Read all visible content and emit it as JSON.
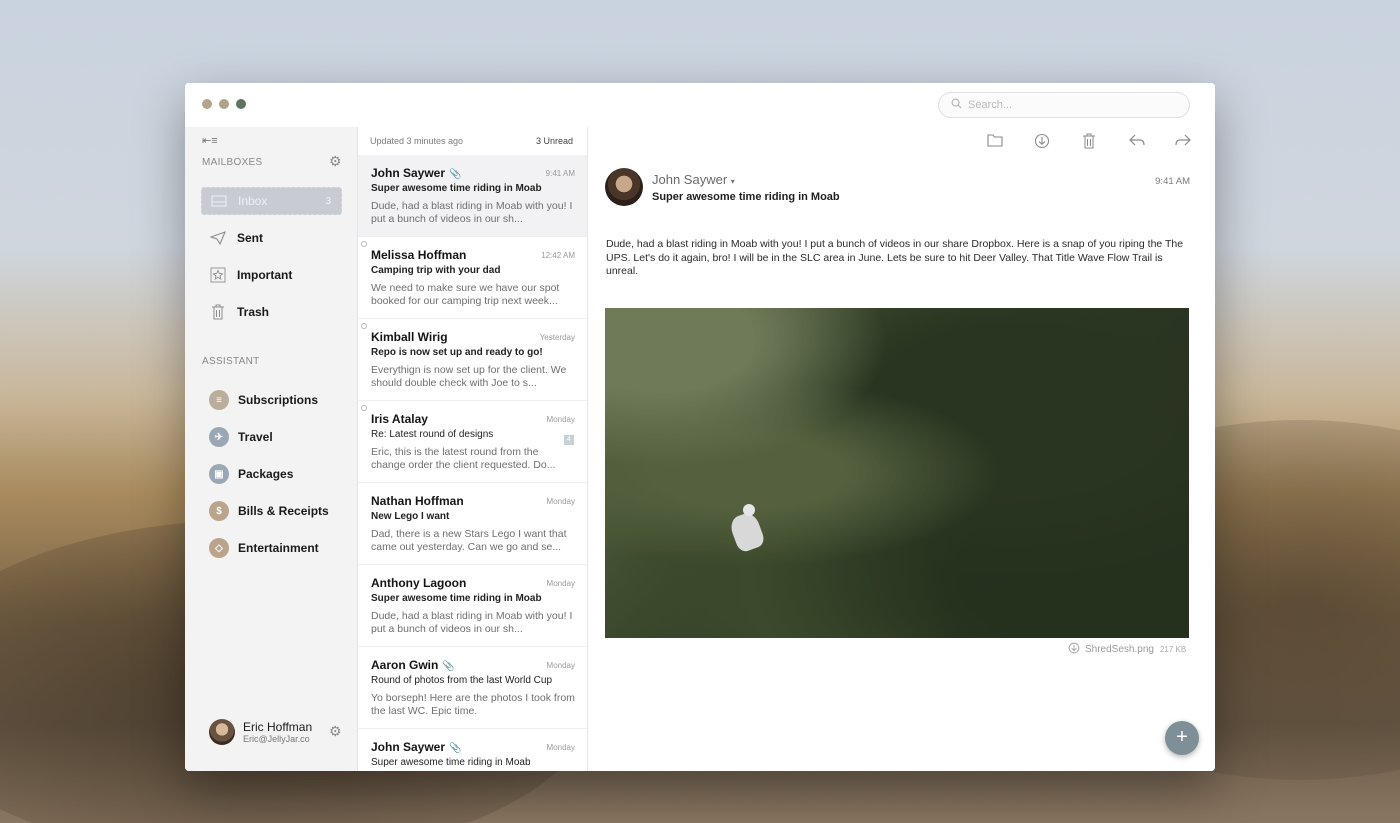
{
  "search": {
    "placeholder": "Search..."
  },
  "sidebar": {
    "mailboxes_title": "MAILBOXES",
    "items": [
      {
        "label": "Inbox",
        "count": "3",
        "icon": "inbox-icon"
      },
      {
        "label": "Sent",
        "icon": "paper-plane-icon"
      },
      {
        "label": "Important",
        "icon": "star-icon"
      },
      {
        "label": "Trash",
        "icon": "trash-icon"
      }
    ],
    "assistant_title": "ASSISTANT",
    "assistant_items": [
      {
        "label": "Subscriptions",
        "icon": "subscriptions-icon"
      },
      {
        "label": "Travel",
        "icon": "globe-icon"
      },
      {
        "label": "Packages",
        "icon": "package-icon"
      },
      {
        "label": "Bills & Receipts",
        "icon": "dollar-icon"
      },
      {
        "label": "Entertainment",
        "icon": "ticket-icon"
      }
    ],
    "profile": {
      "name": "Eric Hoffman",
      "email": "Eric@JellyJar.co"
    }
  },
  "list": {
    "updated": "Updated 3 minutes ago",
    "unread": "3 Unread",
    "messages": [
      {
        "from": "John Saywer",
        "time": "9:41 AM",
        "subject": "Super awesome time riding in Moab",
        "preview": "Dude, had a blast riding in Moab with you!  I put a bunch of videos in our sh..."
      },
      {
        "from": "Melissa Hoffman",
        "time": "12:42 AM",
        "subject": "Camping trip with your dad",
        "preview": "We need to make sure we have our spot booked for our camping trip next week..."
      },
      {
        "from": "Kimball Wirig",
        "time": "Yesterday",
        "subject": "Repo is now set up and ready to go!",
        "preview": "Everythign is now set up for the client. We should double check with Joe to s..."
      },
      {
        "from": "Iris Atalay",
        "time": "Monday",
        "subject": "Re:  Latest round of designs",
        "badge": "4",
        "preview": "Eric, this is the latest round from the change order the client requested.  Do..."
      },
      {
        "from": "Nathan Hoffman",
        "time": "Monday",
        "subject": "New Lego I want",
        "preview": "Dad, there is a new Stars Lego I want that came out yesterday.  Can we go and se..."
      },
      {
        "from": "Anthony Lagoon",
        "time": "Monday",
        "subject": "Super awesome time riding in Moab",
        "preview": "Dude, had a blast riding in Moab with you!  I put a bunch of videos in our sh..."
      },
      {
        "from": "Aaron Gwin",
        "time": "Monday",
        "subject": "Round of photos from the last World Cup",
        "preview": "Yo borseph!  Here are the photos I took from the last WC.  Epic time."
      },
      {
        "from": "John Saywer",
        "time": "Monday",
        "subject": "Super awesome time riding in Moab",
        "preview": ""
      }
    ]
  },
  "reader": {
    "sender": "John Saywer",
    "subject": "Super awesome time riding in Moab",
    "time": "9:41 AM",
    "body": "Dude, had a blast riding in Moab with you!  I put a bunch of videos in our share Dropbox.  Here is a snap of you riping the The UPS.  Let's do it again, bro!  I will be in the SLC area in June.  Lets be sure to hit Deer Valley.  That Title Wave Flow Trail is unreal.",
    "attachment": {
      "name": "ShredSesh.png",
      "size": "217 KB"
    }
  }
}
